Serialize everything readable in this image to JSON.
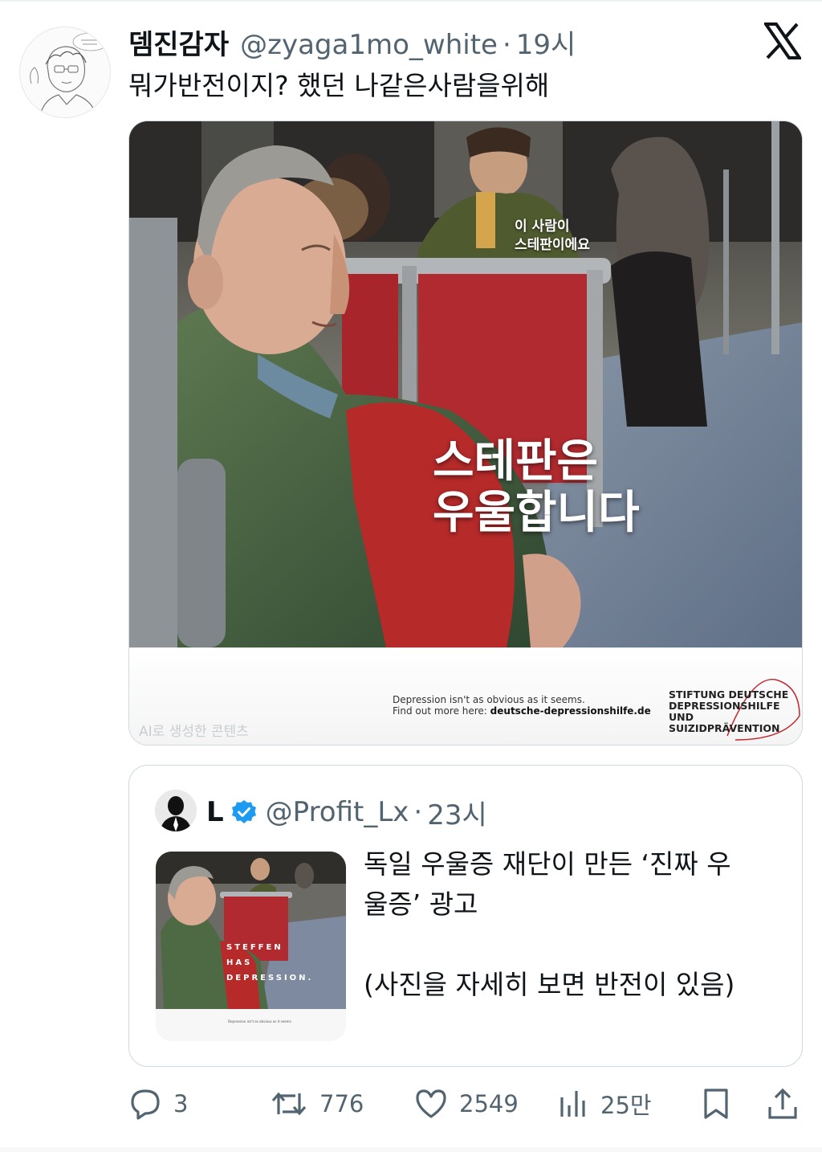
{
  "tweet": {
    "display_name": "뎀진감자",
    "handle": "@zyaga1mo_white",
    "separator": "·",
    "time": "19시",
    "text": "뭐가반전이지? 했던 나같은사람을위해",
    "avatar_icon": "sketched-person-avatar",
    "platform_icon": "x-logo-icon"
  },
  "media": {
    "caption_small": "이 사람이\n스테판이에요",
    "caption_big": "스테판은\n우울합니다",
    "ad_line1": "Depression isn't as obvious as it seems.",
    "ad_line2_prefix": "Find out more here: ",
    "ad_line2_url": "deutsche-depressionshilfe.de",
    "foundation_text": "STIFTUNG DEUTSCHE\nDEPRESSIONSHILFE\nUND SUIZIDPRÄVENTION",
    "ai_label": "AI로 생성한 콘텐츠"
  },
  "quote": {
    "display_name": "L",
    "handle": "@Profit_Lx",
    "separator": "·",
    "time": "23시",
    "verified_icon": "verified-badge-icon",
    "text_line1": "독일 우울증 재단이 만든 ‘진짜 우\n울증’ 광고",
    "text_line2": "(사진을 자세히 보면 반전이 있음)",
    "thumb_caption": "STEFFEN\nHAS\nDEPRESSION."
  },
  "actions": {
    "replies": "3",
    "retweets": "776",
    "likes": "2549",
    "views": "25만"
  },
  "colors": {
    "text_primary": "#0f1419",
    "text_secondary": "#536471",
    "border": "#cfd9de",
    "verified": "#1d9bf0"
  }
}
